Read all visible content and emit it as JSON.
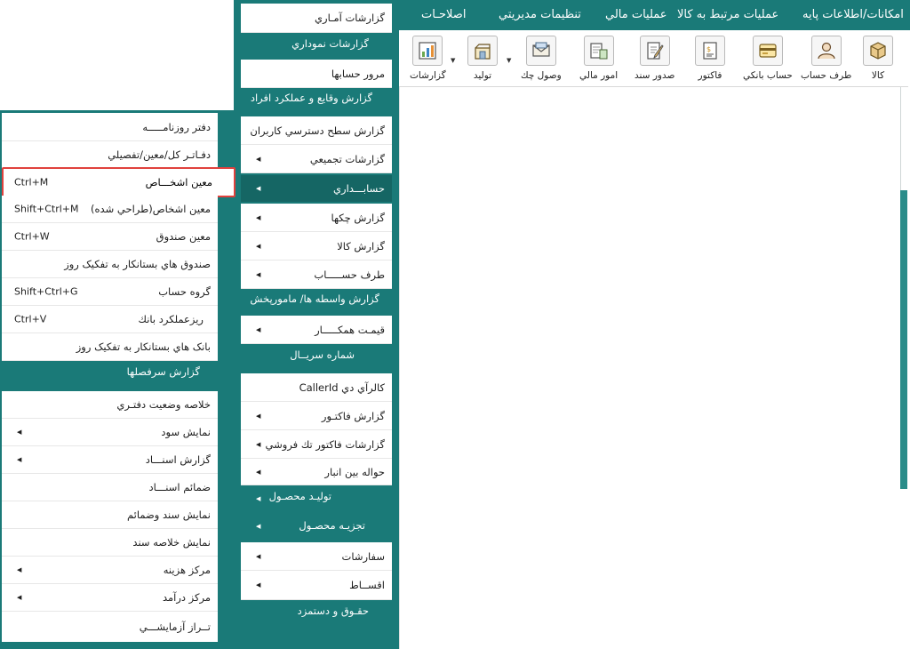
{
  "menubar": {
    "items": [
      "اصلاحـات",
      "تنظيمات مديريتي",
      "عمليات مالي",
      "عمليات مرتبط به کالا",
      "امکانات/اطلاعات پايه"
    ]
  },
  "toolbar": {
    "buttons": [
      {
        "label": "کالا",
        "icon": "box-icon"
      },
      {
        "label": "طرف حساب",
        "icon": "person-icon"
      },
      {
        "label": "حساب بانکي",
        "icon": "bank-card-icon"
      },
      {
        "label": "فاکتور",
        "icon": "invoice-icon"
      },
      {
        "label": "صدور سند",
        "icon": "document-pen-icon"
      },
      {
        "label": "امور مالي",
        "icon": "finance-calculator-icon"
      },
      {
        "label": "وصول چك",
        "icon": "cheque-envelope-icon"
      },
      {
        "label": "توليد",
        "icon": "production-icon"
      },
      {
        "label": "گزارشات",
        "icon": "report-chart-icon"
      }
    ]
  },
  "panel2": {
    "items": [
      "گزارشات آمـاري",
      "گزارشات نموداري",
      "مرور حسابها",
      "گزارش وقايع و عملکرد افراد",
      "گزارش سطح دسترسي کاربران",
      "گزارشات تجميعي",
      "حسابـــداري",
      "گزارش چکها",
      "گزارش کالا",
      "طرف حســـــاب",
      "گزارش واسطه ها/ مامورپخش",
      "قيمـت همکـــــار",
      "شماره سريــال",
      "کالرآي دي CallerId",
      "گزارش فاکتـور",
      "گزارشات فاکتور تك فروشي",
      "حواله بين انبار",
      "توليـد محصـول",
      "تجزيـه محصـول",
      "سفارشات",
      "اقســاط",
      "حقـوق و دستمزد"
    ]
  },
  "panel1": {
    "items": [
      {
        "label": "دفتر روزنامـــــه",
        "shortcut": ""
      },
      {
        "label": "دفـاتـر کل/معين/تفصيلي",
        "shortcut": ""
      },
      {
        "label": "معين اشخـــاص",
        "shortcut": "Ctrl+M"
      },
      {
        "label": "معين اشخاص(طراحي شده)",
        "shortcut": "Shift+Ctrl+M"
      },
      {
        "label": "معين صندوق",
        "shortcut": "Ctrl+W"
      },
      {
        "label": "صندوق هاي بستانکار به تفکيک روز",
        "shortcut": ""
      },
      {
        "label": "گروه حساب",
        "shortcut": "Shift+Ctrl+G"
      },
      {
        "label": "ريزعملکرد بانك",
        "shortcut": "Ctrl+V"
      },
      {
        "label": "بانک هاي بستانکار به تفکيک روز",
        "shortcut": ""
      },
      {
        "label": "گزارش سرفصلها",
        "shortcut": ""
      },
      {
        "label": "خلاصه وضعيت دفتـري",
        "shortcut": ""
      },
      {
        "label": "نمايش سود",
        "shortcut": ""
      },
      {
        "label": "گزارش   اسنـــاد",
        "shortcut": ""
      },
      {
        "label": "ضمائم اسنـــاد",
        "shortcut": ""
      },
      {
        "label": "نمايش سند وضمائم",
        "shortcut": ""
      },
      {
        "label": "نمايش خلاصه سند",
        "shortcut": ""
      },
      {
        "label": "مرکز هزينه",
        "shortcut": ""
      },
      {
        "label": "مرکز درآمد",
        "shortcut": ""
      },
      {
        "label": "تــراز آزمايشـــي",
        "shortcut": ""
      }
    ]
  },
  "colors": {
    "accent": "#1a7a78",
    "highlight_border": "#e0413d"
  }
}
